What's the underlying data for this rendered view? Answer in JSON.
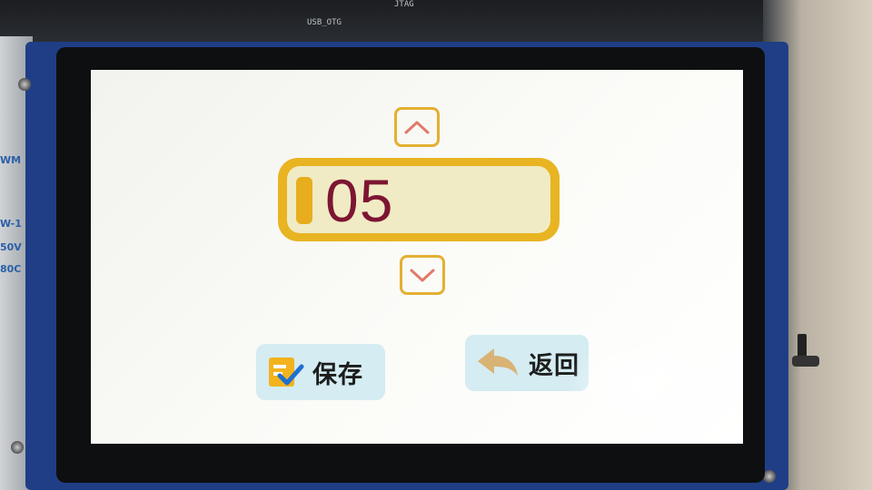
{
  "photo_context": {
    "pcb_labels": [
      "USB_OTG",
      "JTAG"
    ],
    "side_strip_labels": [
      "WM",
      "W-1",
      "50V",
      "80C"
    ]
  },
  "screen": {
    "value_display": {
      "value": "05"
    },
    "up_button": {
      "icon": "chevron-up-icon"
    },
    "down_button": {
      "icon": "chevron-down-icon"
    },
    "save_button": {
      "label": "保存",
      "icon": "save-checkmark-icon"
    },
    "back_button": {
      "label": "返回",
      "icon": "return-arrow-icon"
    },
    "colors": {
      "accent_yellow": "#e8b421",
      "value_text": "#7d1532",
      "value_field": "#f0ebc4",
      "button_bg": "#d4ecf2",
      "chevron": "#e07a6a"
    }
  }
}
